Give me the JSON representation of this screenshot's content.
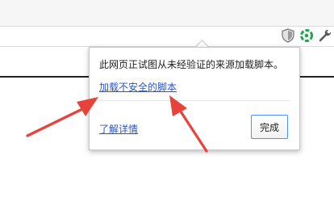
{
  "toolbar": {
    "icons": [
      "shield-icon",
      "recycle-icon",
      "wrench-icon"
    ]
  },
  "popup": {
    "message": "此网页正试图从未经验证的来源加载脚本。",
    "load_unsafe_link": "加载不安全的脚本",
    "learn_more_link": "了解详情",
    "done_button": "完成"
  },
  "colors": {
    "link": "#2a56c6",
    "annotation_arrow": "#e8433a",
    "button_border": "#4d90fe"
  }
}
